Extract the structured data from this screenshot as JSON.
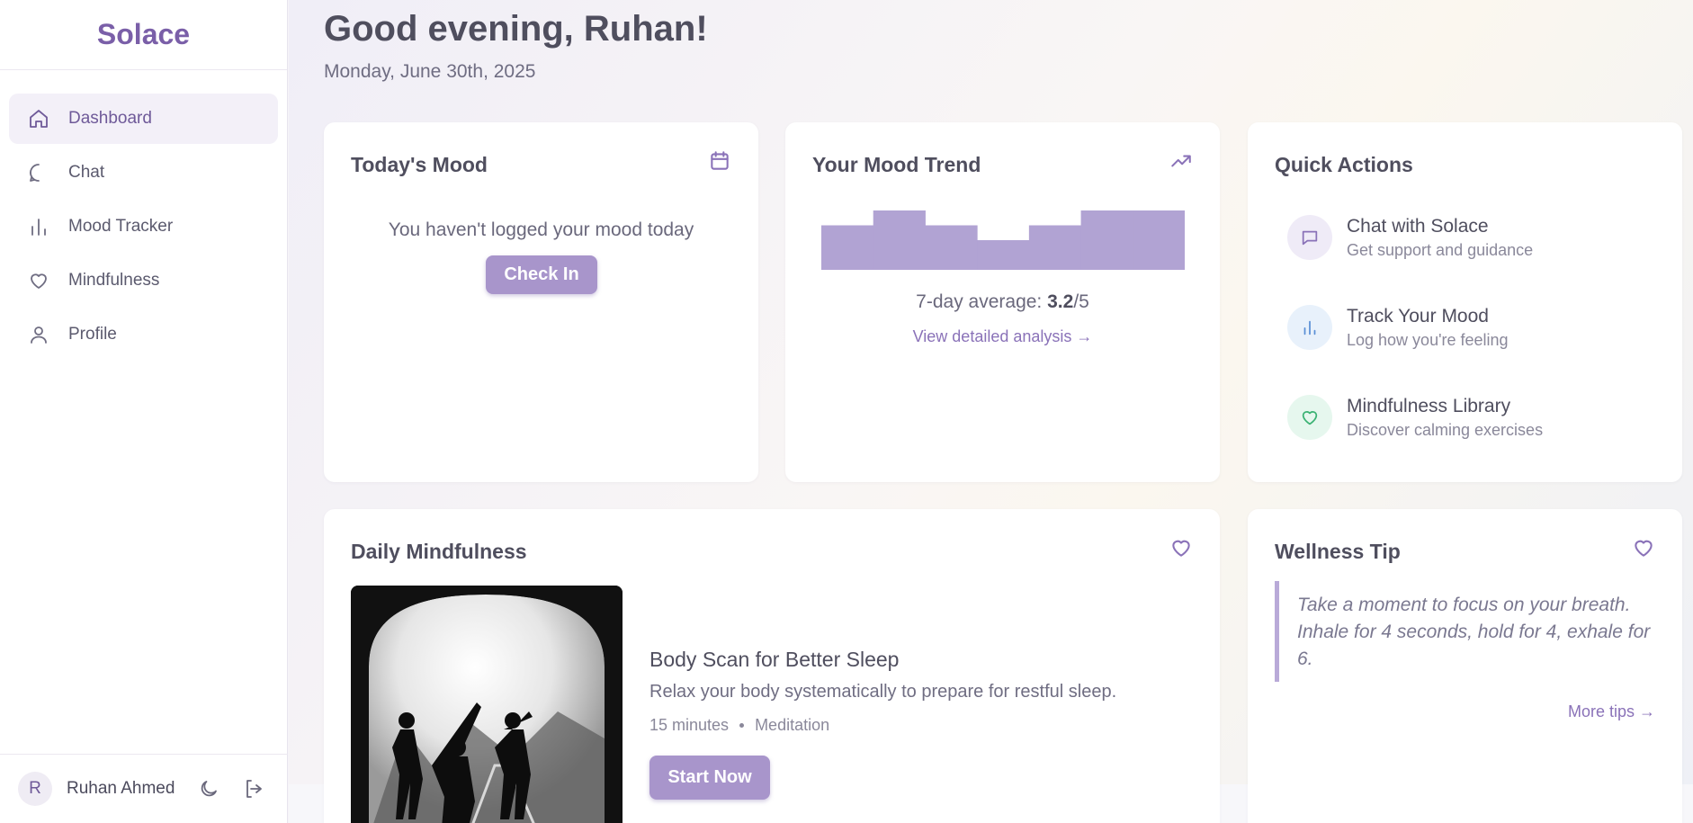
{
  "app": {
    "brand": "Solace"
  },
  "sidebar": {
    "items": [
      {
        "label": "Dashboard",
        "icon": "home-icon",
        "active": true
      },
      {
        "label": "Chat",
        "icon": "chat-bubble-icon",
        "active": false
      },
      {
        "label": "Mood Tracker",
        "icon": "bar-chart-icon",
        "active": false
      },
      {
        "label": "Mindfulness",
        "icon": "heart-icon",
        "active": false
      },
      {
        "label": "Profile",
        "icon": "user-icon",
        "active": false
      }
    ],
    "user": {
      "initial": "R",
      "name": "Ruhan Ahmed"
    }
  },
  "header": {
    "greeting": "Good evening, Ruhan!",
    "date": "Monday, June 30th, 2025"
  },
  "todays_mood": {
    "title": "Today's Mood",
    "message": "You haven't logged your mood today",
    "button": "Check In"
  },
  "mood_trend": {
    "title": "Your Mood Trend",
    "average_label": "7-day average: ",
    "average_value": "3.2",
    "average_suffix": "/5",
    "link": "View detailed analysis →",
    "bar_color": "#b1a3d3",
    "values": [
      3,
      4,
      3,
      2,
      3,
      4,
      4
    ],
    "max": 4
  },
  "quick_actions": {
    "title": "Quick Actions",
    "items": [
      {
        "title": "Chat with Solace",
        "subtitle": "Get support and guidance",
        "icon": "chat-bubble-icon",
        "bg": "#efebf7",
        "color": "#8a72b8"
      },
      {
        "title": "Track Your Mood",
        "subtitle": "Log how you're feeling",
        "icon": "bar-chart-icon",
        "bg": "#e8f1fb",
        "color": "#5a8fd6"
      },
      {
        "title": "Mindfulness Library",
        "subtitle": "Discover calming exercises",
        "icon": "heart-icon",
        "bg": "#e6f7ee",
        "color": "#3bb273"
      }
    ]
  },
  "daily_mindfulness": {
    "title": "Daily Mindfulness",
    "session_title": "Body Scan for Better Sleep",
    "description": "Relax your body systematically to prepare for restful sleep.",
    "duration": "15 minutes",
    "category": "Meditation",
    "button": "Start Now"
  },
  "wellness_tip": {
    "title": "Wellness Tip",
    "text": "Take a moment to focus on your breath. Inhale for 4 seconds, hold for 4, exhale for 6.",
    "link": "More tips →"
  }
}
